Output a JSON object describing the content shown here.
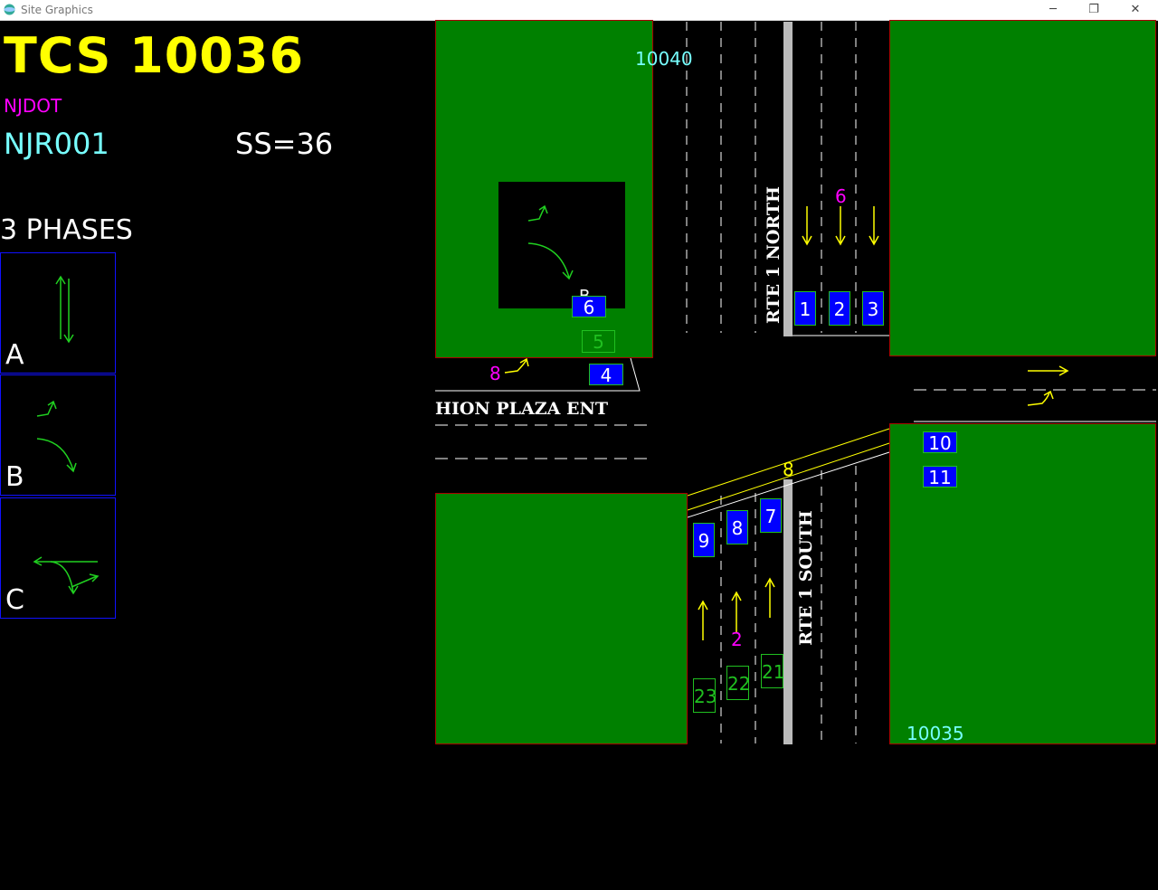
{
  "window": {
    "title": "Site Graphics",
    "minimize": "─",
    "restore": "❐",
    "close": "✕"
  },
  "header": {
    "title": "TCS 10036",
    "agency": "NJDOT",
    "site_code": "NJR001",
    "ss": "SS=36"
  },
  "phases": {
    "label": "3 PHASES",
    "items": [
      {
        "letter": "A"
      },
      {
        "letter": "B"
      },
      {
        "letter": "C"
      }
    ]
  },
  "map": {
    "tcs_north": "10040",
    "tcs_south": "10035",
    "road_north": "RTE 1 NORTH",
    "road_south": "RTE 1 SOUTH",
    "road_west": "HION PLAZA ENT",
    "phase_nums": {
      "north": "6",
      "west": "8",
      "south": "2",
      "median": "8"
    },
    "detectors_blue": [
      "1",
      "2",
      "3",
      "4",
      "6",
      "7",
      "8",
      "9",
      "10",
      "11"
    ],
    "detectors_green": [
      "5",
      "21",
      "22",
      "23"
    ],
    "hidden_b": "B"
  },
  "colors": {
    "title": "#ffff00",
    "agency": "#ff00ff",
    "code": "#77ffff",
    "block": "#008000",
    "detector": "#0000ff"
  }
}
